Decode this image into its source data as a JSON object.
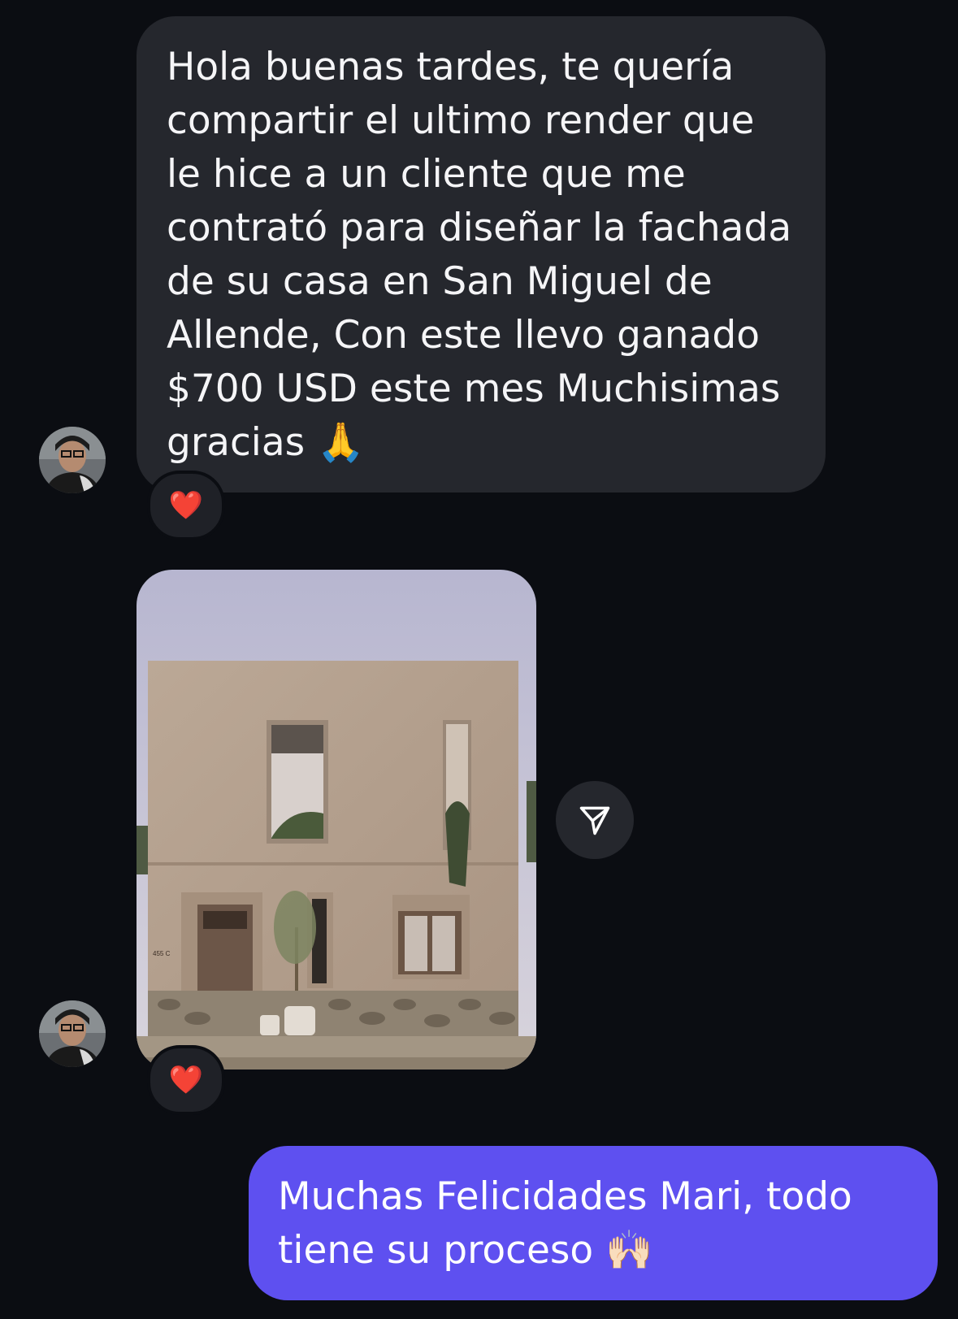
{
  "messages": {
    "incoming_text": "Hola buenas tardes, te quería compartir el ultimo render que le hice a un cliente que me contrató para diseñar la fachada de su casa en San Miguel de Allende, Con este llevo ganado $700 USD este mes Muchisimas gracias 🙏",
    "outgoing_text": "Muchas Felicidades Mari, todo tiene su proceso 🙌🏻",
    "house_number_plate": "455 C"
  },
  "reactions": {
    "text_reaction": "❤️",
    "image_reaction": "❤️"
  },
  "colors": {
    "background": "#0b0d12",
    "incoming_bubble": "#25272d",
    "outgoing_bubble": "#5e50f0",
    "heart": "#e8232f"
  },
  "icons": {
    "share": "paper-plane-icon",
    "avatar": "user-avatar"
  }
}
